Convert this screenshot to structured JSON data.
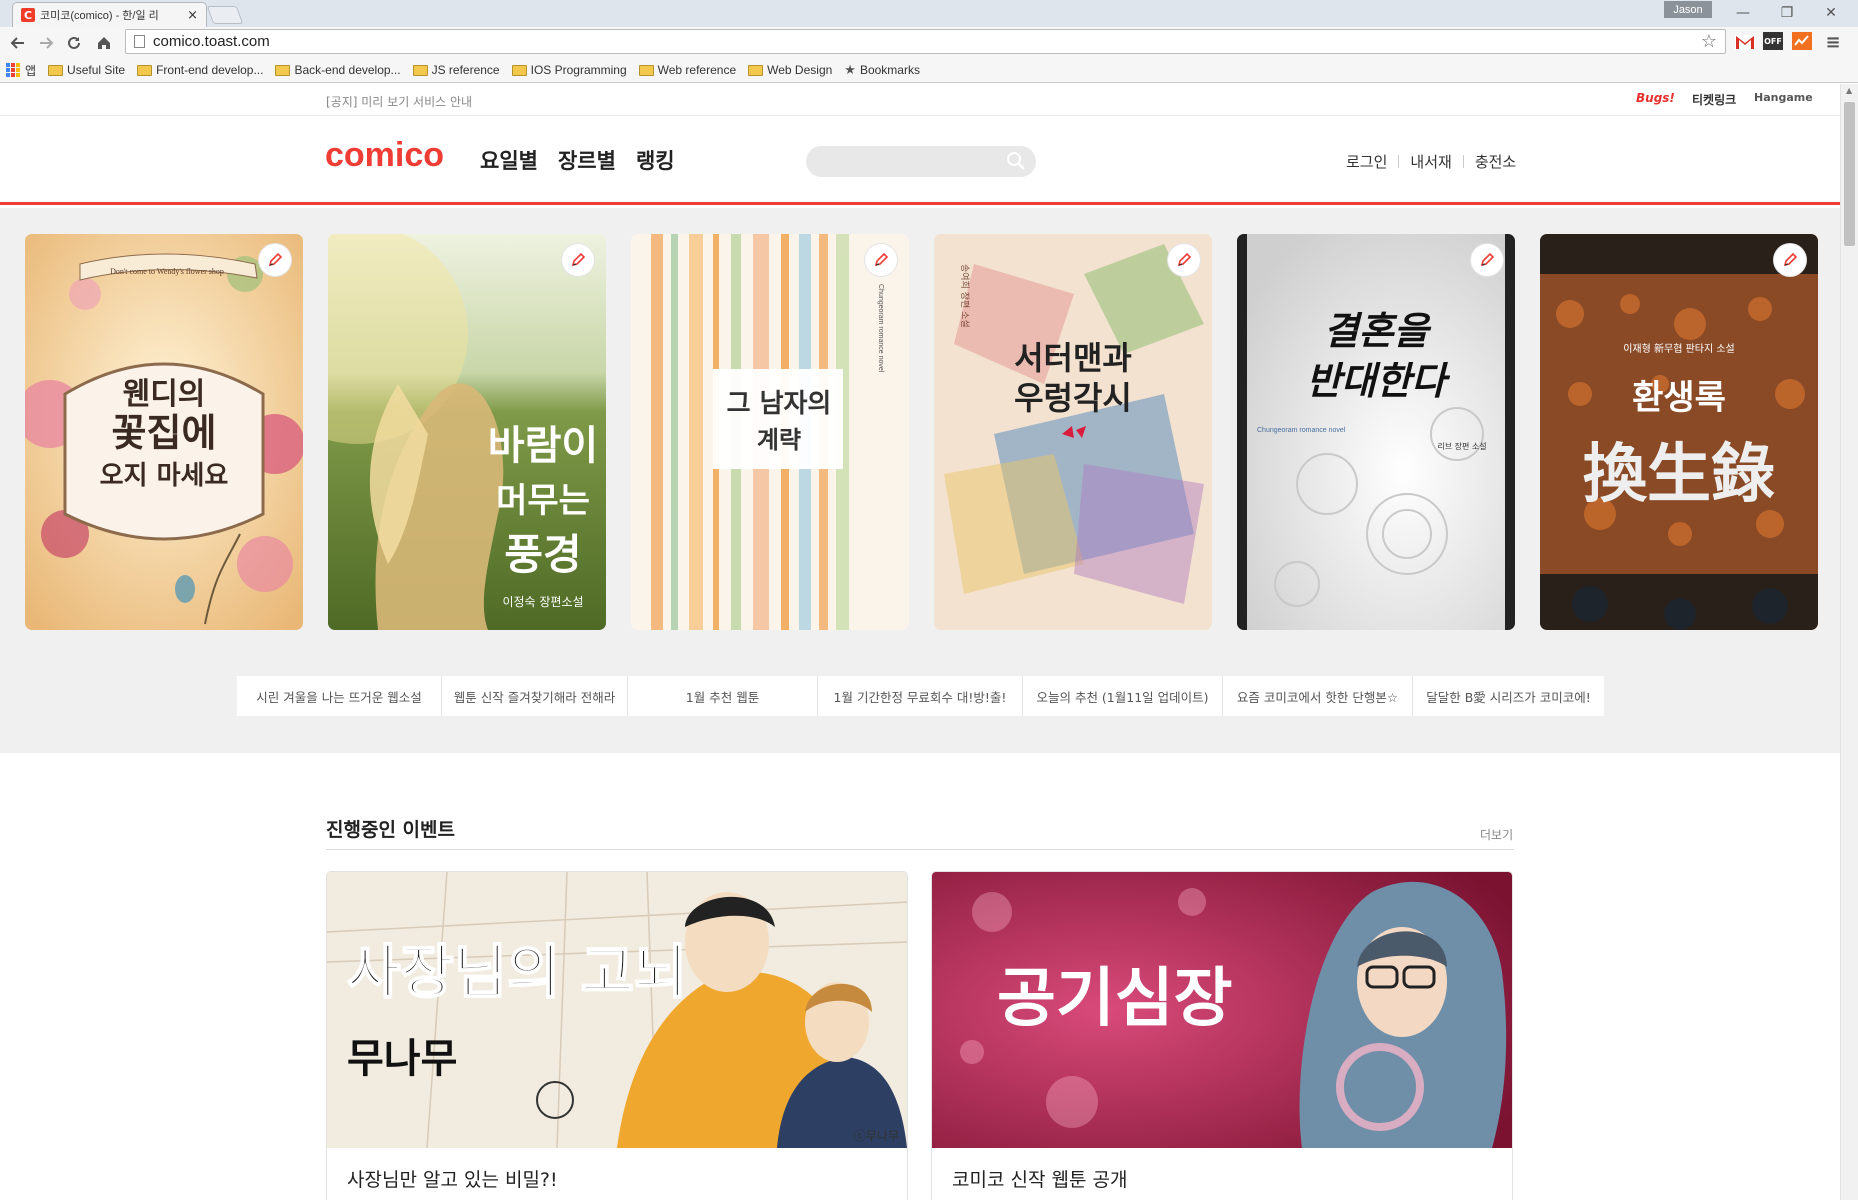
{
  "browser": {
    "tab_title": "코미코(comico) - 한/일 리",
    "tab_favicon": "C",
    "tab_close": "×",
    "user_label": "Jason",
    "url": "comico.toast.com",
    "window_controls": [
      "—",
      "❐",
      "✕"
    ],
    "bookmarks": [
      {
        "label": "앱",
        "icon": "apps-grid-icon"
      },
      {
        "label": "Useful Site",
        "icon": "folder-icon"
      },
      {
        "label": "Front-end develop...",
        "icon": "folder-icon"
      },
      {
        "label": "Back-end develop...",
        "icon": "folder-icon"
      },
      {
        "label": "JS reference",
        "icon": "folder-icon"
      },
      {
        "label": "IOS Programming",
        "icon": "folder-icon"
      },
      {
        "label": "Web reference",
        "icon": "folder-icon"
      },
      {
        "label": "Web Design",
        "icon": "folder-icon"
      },
      {
        "label": "Bookmarks",
        "icon": "star-icon"
      }
    ],
    "extensions": [
      "gmail-icon",
      "off-icon",
      "analytics-icon",
      "menu-icon"
    ]
  },
  "topbar": {
    "notice": "[공지] 미리 보기 서비스 안내",
    "partners": [
      "Bugs!",
      "티켓링크",
      "Hangame"
    ]
  },
  "header": {
    "logo": "comico",
    "nav": [
      "요일별",
      "장르별",
      "랭킹"
    ],
    "search_placeholder": "",
    "util": [
      "로그인",
      "내서재",
      "충전소"
    ]
  },
  "covers": [
    {
      "title_lines": [
        "웬디의",
        "꽃집에",
        "오지 마세요"
      ],
      "top_text": "Don't come to Wendy's flower shop",
      "colors": {
        "bg": "#f4d9a6",
        "accent": "#c84868"
      }
    },
    {
      "title_lines": [
        "바람이",
        "머무는",
        "풍경"
      ],
      "author": "이정숙 장편소설",
      "colors": {
        "bg": "#7f9a48",
        "accent": "#e8d890"
      }
    },
    {
      "title_lines": [
        "그 남자의",
        "계략"
      ],
      "side_text": "Chungeoram romance novel",
      "colors": {
        "bg": "#fbf4ea",
        "accent": "#ef9a3a"
      }
    },
    {
      "title_lines": [
        "서터맨과",
        "우렁각시"
      ],
      "top_text": "송여희 장편 소설",
      "colors": {
        "bg": "#f3e2d0",
        "accent": "#5c8fc0"
      }
    },
    {
      "title_lines": [
        "결혼을",
        "반대한다"
      ],
      "author": "리브 장편 소설",
      "side_text": "Chungeoram romance novel",
      "colors": {
        "bg": "#f2f2f2",
        "accent": "#222222"
      }
    },
    {
      "title_lines": [
        "환생록",
        "換生錄"
      ],
      "top_text": "이재형 新무협 판타지 소설",
      "colors": {
        "bg": "#3d2a1e",
        "accent": "#d1702e"
      }
    }
  ],
  "topics": [
    "시린 겨울을 나는 뜨거운 웹소설",
    "웹툰 신작 즐겨찾기해라 전해라",
    "1월 추천 웹툰",
    "1월 기간한정 무료회수 대!방!출!",
    "오늘의 추천 (1월11일 업데이트)",
    "요즘 코미코에서 핫한 단행본☆",
    "달달한 B愛 시리즈가 코미코에!"
  ],
  "events_section": {
    "title": "진행중인 이벤트",
    "more": "더보기",
    "cards": [
      {
        "image_title": "사장님의 고뇌",
        "image_sub": "무나무",
        "credit": "ⓒ무나무",
        "title": "사장님만 알고 있는 비밀?!",
        "subtitle": "",
        "date": ""
      },
      {
        "image_title": "공기심장",
        "title": "코미코 신작 웹툰 공개",
        "subtitle": "",
        "date": ""
      }
    ]
  }
}
